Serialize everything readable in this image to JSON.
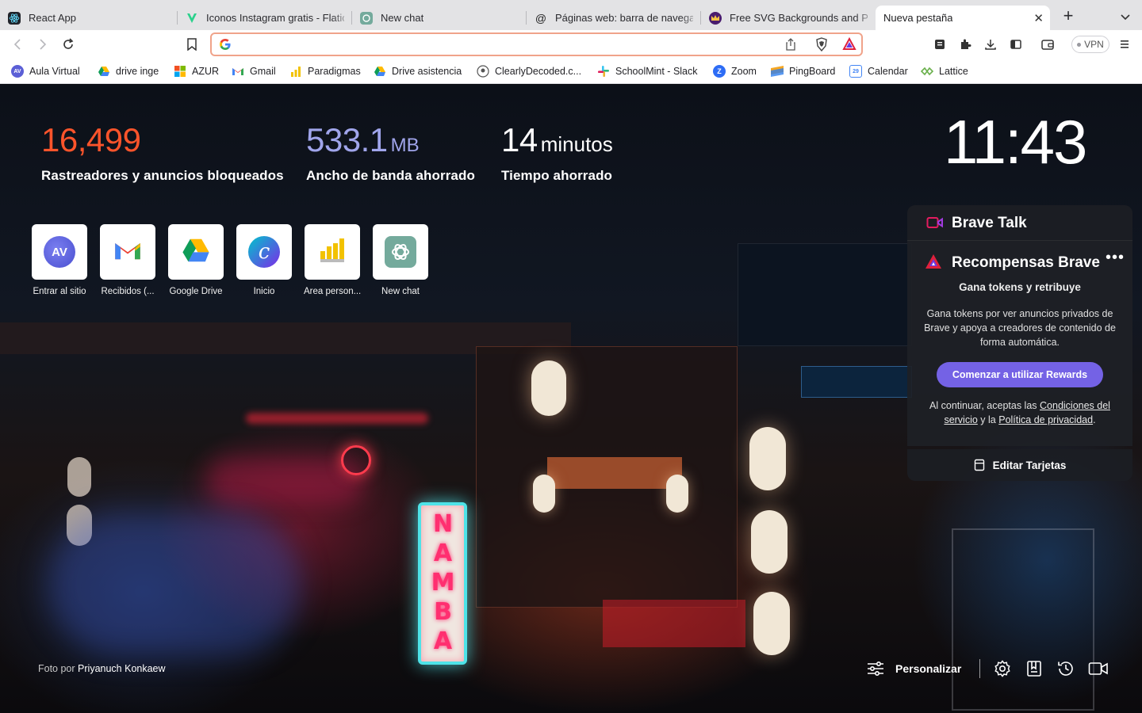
{
  "tabs": [
    {
      "label": "React App",
      "icon": "react-icon"
    },
    {
      "label": "Iconos Instagram gratis - Flaticon",
      "icon": "flaticon-icon"
    },
    {
      "label": "New chat",
      "icon": "chatgpt-icon"
    },
    {
      "label": "Páginas web: barra de navegación",
      "icon": "at-sign-icon"
    },
    {
      "label": "Free SVG Backgrounds and Patterns",
      "icon": "crown-icon"
    },
    {
      "label": "Nueva pestaña",
      "icon": "none",
      "active": true
    }
  ],
  "address_bar": {
    "value": "",
    "placeholder": ""
  },
  "toolbar": {
    "vpn_label": "VPN"
  },
  "bookmarks": [
    {
      "label": "Aula Virtual",
      "icon": "av-icon"
    },
    {
      "label": "drive inge",
      "icon": "google-drive-icon"
    },
    {
      "label": "AZUR",
      "icon": "windows-icon"
    },
    {
      "label": "Gmail",
      "icon": "gmail-icon"
    },
    {
      "label": "Paradigmas",
      "icon": "bar-chart-icon"
    },
    {
      "label": "Drive asistencia",
      "icon": "google-drive-icon"
    },
    {
      "label": "ClearlyDecoded.c...",
      "icon": "clearlydecoded-icon"
    },
    {
      "label": "SchoolMint - Slack",
      "icon": "slack-icon"
    },
    {
      "label": "Zoom",
      "icon": "zoom-icon"
    },
    {
      "label": "PingBoard",
      "icon": "pingboard-icon"
    },
    {
      "label": "Calendar",
      "icon": "calendar-icon"
    },
    {
      "label": "Lattice",
      "icon": "lattice-icon"
    }
  ],
  "stats": {
    "trackers": {
      "value": "16,499",
      "label": "Rastreadores y anuncios bloqueados",
      "color": "#fb542b"
    },
    "bandwidth": {
      "value": "533.1",
      "unit": "MB",
      "label": "Ancho de banda ahorrado",
      "color": "#a0a5eb"
    },
    "time": {
      "value": "14",
      "unit": "minutos",
      "label": "Tiempo ahorrado"
    }
  },
  "clock": "11:43",
  "top_sites": [
    {
      "label": "Entrar al sitio",
      "icon": "av-icon"
    },
    {
      "label": "Recibidos (...",
      "icon": "gmail-icon"
    },
    {
      "label": "Google Drive",
      "icon": "google-drive-icon"
    },
    {
      "label": "Inicio",
      "icon": "canva-icon"
    },
    {
      "label": "Área person...",
      "icon": "bar-chart-icon"
    },
    {
      "label": "New chat",
      "icon": "chatgpt-icon"
    }
  ],
  "brave_talk": {
    "title": "Brave Talk"
  },
  "rewards": {
    "title": "Recompensas Brave",
    "subtitle": "Gana tokens y retribuye",
    "description": "Gana tokens por ver anuncios privados de Brave y apoya a creadores de contenido de forma automática.",
    "cta": "Comenzar a utilizar Rewards",
    "terms_prefix": "Al continuar, aceptas las",
    "terms_link": "Condiciones del servicio",
    "terms_mid": "y la",
    "privacy_link": "Política de privacidad",
    "terms_suffix": ".",
    "accent": "#7462e5"
  },
  "edit_cards": {
    "label": "Editar Tarjetas"
  },
  "photo_credit": {
    "prefix": "Foto por",
    "author": "Priyanuch Konkaew"
  },
  "footer": {
    "customize_label": "Personalizar"
  },
  "scene_sign": {
    "text": "NAMBA"
  }
}
